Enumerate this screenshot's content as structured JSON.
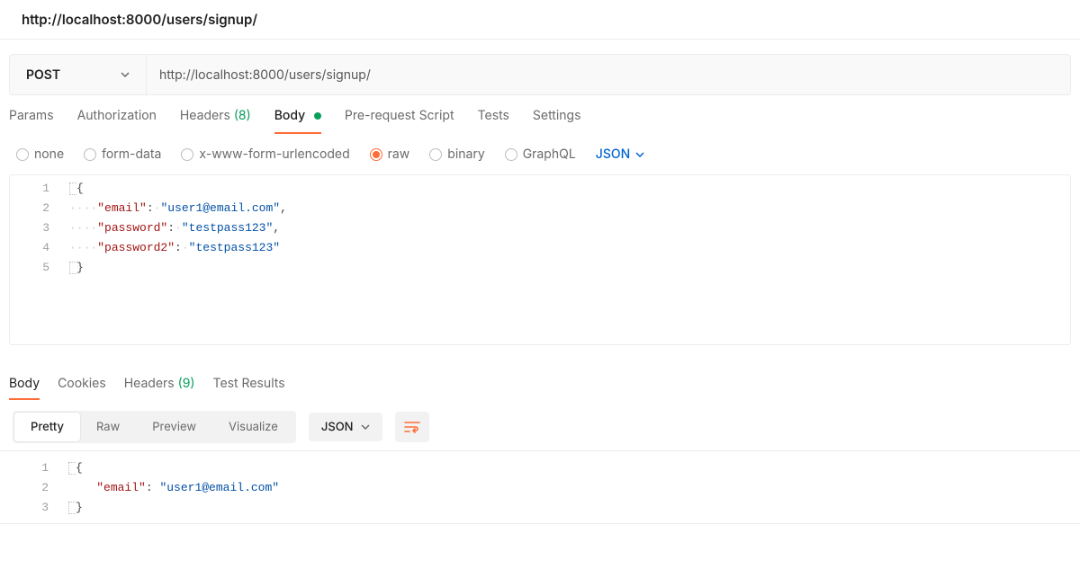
{
  "page_title": "http://localhost:8000/users/signup/",
  "method": "POST",
  "url": "http://localhost:8000/users/signup/",
  "request_tabs": {
    "params": "Params",
    "auth": "Authorization",
    "headers_label": "Headers",
    "headers_count": "(8)",
    "body": "Body",
    "pre": "Pre-request Script",
    "tests": "Tests",
    "settings": "Settings"
  },
  "body_types": {
    "none": "none",
    "form": "form-data",
    "urlenc": "x-www-form-urlencoded",
    "raw": "raw",
    "binary": "binary",
    "graphql": "GraphQL"
  },
  "raw_type": "JSON",
  "request_code": {
    "l1": "{",
    "l2_k": "\"email\"",
    "l2_v": "\"user1@email.com\"",
    "l3_k": "\"password\"",
    "l3_v": "\"testpass123\"",
    "l4_k": "\"password2\"",
    "l4_v": "\"testpass123\"",
    "l5": "}"
  },
  "response_tabs": {
    "body": "Body",
    "cookies": "Cookies",
    "headers_label": "Headers",
    "headers_count": "(9)",
    "tests": "Test Results"
  },
  "view_modes": {
    "pretty": "Pretty",
    "raw": "Raw",
    "preview": "Preview",
    "visualize": "Visualize"
  },
  "resp_format": "JSON",
  "response_code": {
    "l1": "{",
    "l2_k": "\"email\"",
    "l2_v": "\"user1@email.com\"",
    "l3": "}"
  }
}
